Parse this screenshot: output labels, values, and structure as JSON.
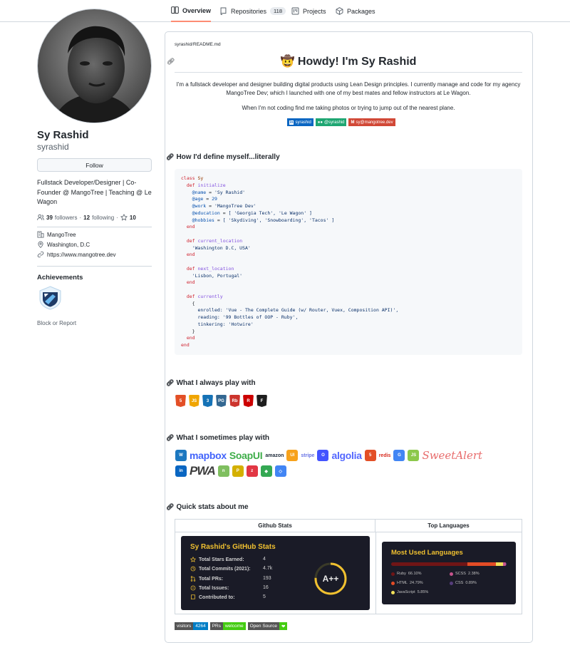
{
  "nav": {
    "tabs": [
      {
        "label": "Overview",
        "icon": "book-icon"
      },
      {
        "label": "Repositories",
        "icon": "repo-icon",
        "count": "118"
      },
      {
        "label": "Projects",
        "icon": "project-icon"
      },
      {
        "label": "Packages",
        "icon": "package-icon"
      }
    ]
  },
  "profile": {
    "name": "Sy Rashid",
    "login": "syrashid",
    "follow_label": "Follow",
    "bio": "Fullstack Developer/Designer | Co-Founder @ MangoTree | Teaching @ Le Wagon",
    "followers_count": "39",
    "followers_label": "followers",
    "following_count": "12",
    "following_label": "following",
    "stars_count": "10",
    "company": "MangoTree",
    "location": "Washington, D.C",
    "website": "https://www.mangotree.dev",
    "achievements_title": "Achievements",
    "block_label": "Block or Report"
  },
  "readme": {
    "path_user": "syrashid",
    "path_sep": "/",
    "path_file": "README.md",
    "title": "🤠 Howdy! I'm Sy Rashid",
    "intro": "I'm a fullstack developer and designer building digital products using Lean Design principles. I currently manage and code for my agency MangoTree Dev; which I launched with one of my best mates and fellow instructors at Le Wagon.",
    "hobby": "When I'm not coding find me taking photos or trying to jump out of the nearest plane.",
    "shields": [
      {
        "label": "syrashid",
        "color": "#0a66c2",
        "icon": "linkedin-icon"
      },
      {
        "label": "@syrashid",
        "color": "#1ea672",
        "icon": "medium-icon"
      },
      {
        "label": "sy@mangotree.dev",
        "color": "#d14836",
        "icon": "gmail-icon"
      }
    ],
    "h2_define": "How I'd define myself...literally",
    "h2_always": "What I always play with",
    "h2_sometimes": "What I sometimes play with",
    "h2_stats": "Quick stats about me",
    "code": {
      "l1a": "class",
      "l1b": "Sy",
      "def": "def",
      "end": "end",
      "initialize": "initialize",
      "name_var": "@name",
      "name_val": "'Sy Rashid'",
      "age_var": "@age",
      "age_val": "29",
      "work_var": "@work",
      "work_val": "'MangoTree Dev'",
      "edu_var": "@education",
      "edu_val": "[ 'Georgia Tech', 'Le Wagon' ]",
      "hob_var": "@hobbies",
      "hob_val": "[ 'Skydiving', 'Snowboarding', 'Tacos' ]",
      "current_location": "current_location",
      "current_location_val": "'Washington D.C, USA'",
      "next_location": "next_location",
      "next_location_val": "'Lisbon, Portugal'",
      "currently": "currently",
      "enrolled": "enrolled: 'Vue - The Complete Guide (w/ Router, Vuex, Composition API)',",
      "reading": "reading: '99 Bottles of OOP - Ruby',",
      "tinkering": "tinkering: 'Hotwire'"
    },
    "always_tech": [
      {
        "name": "html5-icon",
        "color": "#e34f26",
        "label": "5"
      },
      {
        "name": "javascript-icon",
        "color": "#f0a500",
        "label": "JS"
      },
      {
        "name": "css3-icon",
        "color": "#1572b6",
        "label": "3"
      },
      {
        "name": "postgresql-icon",
        "color": "#336791",
        "label": "PG"
      },
      {
        "name": "ruby-icon",
        "color": "#cc342d",
        "label": "Rb"
      },
      {
        "name": "rails-icon",
        "color": "#cc0000",
        "label": "R"
      },
      {
        "name": "figma-icon",
        "color": "#1e1e1e",
        "label": "F"
      }
    ],
    "sometimes_row1": [
      {
        "name": "webpack-icon",
        "kind": "icon",
        "color": "#1c78c0",
        "label": "W"
      },
      {
        "name": "mapbox-logo",
        "kind": "text",
        "color": "#4264fb",
        "label": "mapbox"
      },
      {
        "name": "soapui-logo",
        "kind": "text",
        "color": "#3fae4a",
        "label": "SoapUI"
      },
      {
        "name": "amazon-logo",
        "kind": "small",
        "color": "#232f3e",
        "label": "amazon"
      },
      {
        "name": "uikit-icon",
        "kind": "icon",
        "color": "#f7a21b",
        "label": "UI"
      },
      {
        "name": "stripe-logo",
        "kind": "small",
        "color": "#6772e5",
        "label": "stripe"
      },
      {
        "name": "webflow-icon",
        "kind": "icon",
        "color": "#4353ff",
        "label": "O"
      },
      {
        "name": "algolia-logo",
        "kind": "text",
        "color": "#5468ff",
        "label": "algolia"
      },
      {
        "name": "html5-icon",
        "kind": "icon",
        "color": "#e34f26",
        "label": "5"
      },
      {
        "name": "redis-logo",
        "kind": "small",
        "color": "#d82c20",
        "label": "redis"
      },
      {
        "name": "google-icon",
        "kind": "icon",
        "color": "#4285f4",
        "label": "G"
      },
      {
        "name": "nodejs-icon",
        "kind": "icon",
        "color": "#8cc84b",
        "label": "JS"
      },
      {
        "name": "sweetalert-logo",
        "kind": "script",
        "color": "#e86d6d",
        "label": "SweetAlert"
      }
    ],
    "sometimes_row2": [
      {
        "name": "linkedin-icon",
        "kind": "icon",
        "color": "#0a66c2",
        "label": "in"
      },
      {
        "name": "pwa-logo",
        "kind": "pwa",
        "color": "#3d3d3d",
        "label": "PWA"
      },
      {
        "name": "netlify-icon",
        "kind": "icon",
        "color": "#7fbf5f",
        "label": "n"
      },
      {
        "name": "producthunt-icon",
        "kind": "icon",
        "color": "#d4b000",
        "label": "P"
      },
      {
        "name": "zomato-icon",
        "kind": "icon",
        "color": "#e23744",
        "label": "z"
      },
      {
        "name": "google-maps-icon",
        "kind": "icon",
        "color": "#34a853",
        "label": "◆"
      },
      {
        "name": "google-cloud-icon",
        "kind": "icon",
        "color": "#4285f4",
        "label": "◇"
      }
    ],
    "stats_table": {
      "col1": "Github Stats",
      "col2": "Top Languages"
    },
    "stats_card": {
      "title": "Sy Rashid's GitHub Stats",
      "rows": [
        {
          "label": "Total Stars Earned:",
          "value": "4",
          "icon": "star-icon"
        },
        {
          "label": "Total Commits (2021):",
          "value": "4.7k",
          "icon": "history-icon"
        },
        {
          "label": "Total PRs:",
          "value": "193",
          "icon": "pull-request-icon"
        },
        {
          "label": "Total Issues:",
          "value": "16",
          "icon": "issue-icon"
        },
        {
          "label": "Contributed to:",
          "value": "5",
          "icon": "repo-icon"
        }
      ],
      "grade": "A++",
      "accent": "#f0c030"
    },
    "lang_card": {
      "title": "Most Used Languages",
      "langs": [
        {
          "name": "Ruby",
          "pct": "66.10%",
          "value": 66.1,
          "color": "#701516"
        },
        {
          "name": "HTML",
          "pct": "24.79%",
          "value": 24.79,
          "color": "#e34c26"
        },
        {
          "name": "JavaScript",
          "pct": "5.85%",
          "value": 5.85,
          "color": "#f1e05a"
        },
        {
          "name": "SCSS",
          "pct": "2.38%",
          "value": 2.38,
          "color": "#c6538c"
        },
        {
          "name": "CSS",
          "pct": "0.89%",
          "value": 0.89,
          "color": "#563d7c"
        }
      ]
    },
    "bottom_badges": [
      {
        "left": "visitors",
        "right": "4264",
        "lcolor": "#555",
        "rcolor": "#007ec6"
      },
      {
        "left": "PRs",
        "right": "welcome",
        "lcolor": "#555",
        "rcolor": "#4c1"
      },
      {
        "left": "Open Source",
        "right": "❤",
        "lcolor": "#555",
        "rcolor": "#44cc11"
      }
    ]
  }
}
